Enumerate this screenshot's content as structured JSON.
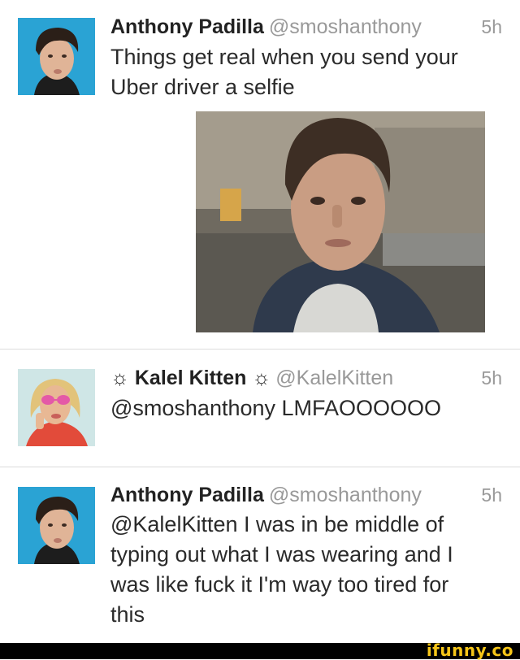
{
  "tweets": [
    {
      "name": "Anthony Padilla",
      "handle": "@smoshanthony",
      "time": "5h",
      "text_lines": [
        "Things get real when you send your",
        "Uber driver a selfie"
      ],
      "avatar_icon": "profile-photo-man"
    },
    {
      "name_prefix": "☼",
      "name": "Kalel Kitten",
      "name_suffix": "☼",
      "handle": "@KalelKitten",
      "time": "5h",
      "text_lines": [
        "@smoshanthony LMFAOOOOOO"
      ],
      "avatar_icon": "profile-photo-woman"
    },
    {
      "name": "Anthony Padilla",
      "handle": "@smoshanthony",
      "time": "5h",
      "text_lines": [
        "@KalelKitten I was in be middle of",
        "typing out what I was wearing and I",
        "was like fuck it I'm way too tired for",
        "this"
      ],
      "avatar_icon": "profile-photo-man"
    }
  ],
  "footer": {
    "watermark": "ifunny.co"
  },
  "colors": {
    "name": "#222222",
    "meta": "#999999",
    "text": "#2a2a2a",
    "divider": "#dcdcdc",
    "footer_bg": "#000000",
    "watermark": "#f5c518"
  }
}
